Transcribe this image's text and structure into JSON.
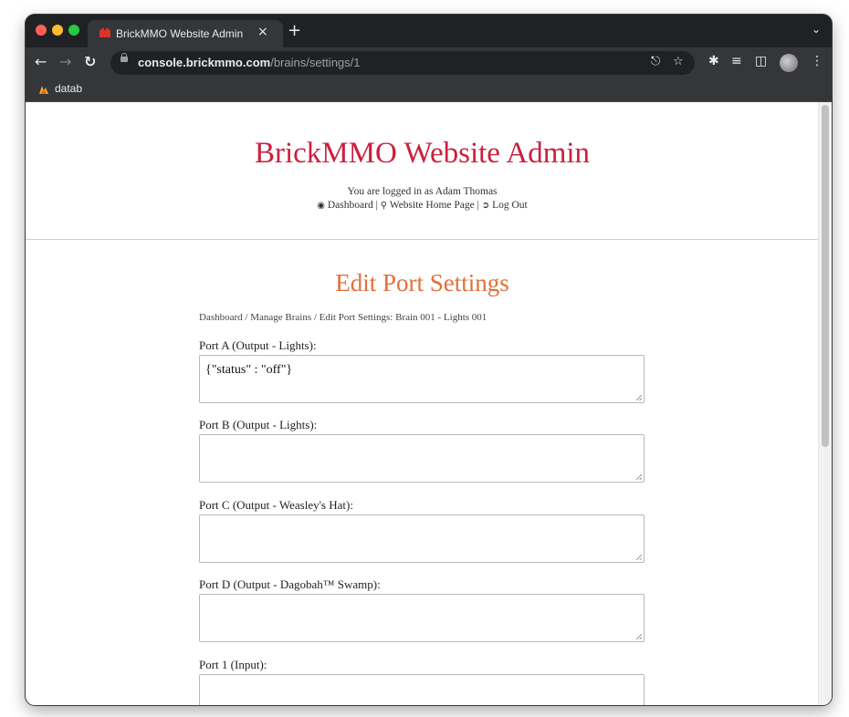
{
  "browser": {
    "tab_title": "BrickMMO Website Admin",
    "tab_close": "×",
    "new_tab": "+",
    "url_host": "console.brickmmo.com",
    "url_path": "/brains/settings/1",
    "bookmark_label": "datab"
  },
  "header": {
    "site_title": "BrickMMO Website Admin",
    "logged_in_text": "You are logged in as Adam Thomas",
    "nav": {
      "dashboard": "Dashboard",
      "sep1": " | ",
      "home": "Website Home Page",
      "sep2": " | ",
      "logout": "Log Out"
    }
  },
  "main": {
    "heading": "Edit Port Settings",
    "breadcrumb": "Dashboard / Manage Brains / Edit Port Settings: Brain 001 - Lights 001",
    "ports": [
      {
        "label": "Port A (Output - Lights):",
        "value": "{\"status\" : \"off\"}"
      },
      {
        "label": "Port B (Output - Lights):",
        "value": ""
      },
      {
        "label": "Port C (Output - Weasley's Hat):",
        "value": ""
      },
      {
        "label": "Port D (Output - Dagobah™ Swamp):",
        "value": ""
      },
      {
        "label": "Port 1 (Input):",
        "value": ""
      }
    ]
  },
  "colors": {
    "site_title": "#cc1f3f",
    "page_heading": "#e0703a"
  }
}
